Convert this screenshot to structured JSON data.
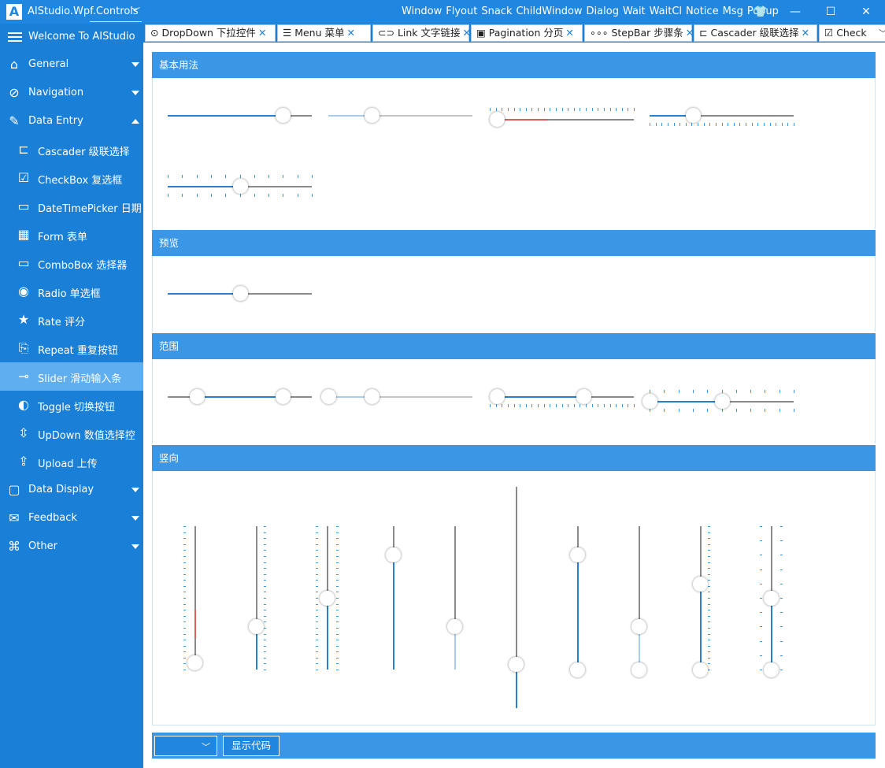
{
  "app": {
    "logo": "A",
    "title": "AIStudio.Wpf.Controls",
    "title_arrow": "﹀",
    "menu": [
      "Window",
      "Flyout",
      "Snack",
      "ChildWindow",
      "Dialog",
      "Wait",
      "WaitCl",
      "Notice",
      "Msg",
      "Popup"
    ],
    "window_buttons": {
      "skin": "👕",
      "minimize": "—",
      "maximize": "☐",
      "close": "✕"
    }
  },
  "sidebar": {
    "header": "Welcome To AIStudio",
    "items": [
      {
        "label": "General",
        "icon": "home-icon",
        "glyph": "⌂",
        "expand": "down"
      },
      {
        "label": "Navigation",
        "icon": "compass-icon",
        "glyph": "⊘",
        "expand": "down"
      },
      {
        "label": "Data Entry",
        "icon": "edit-icon",
        "glyph": "✎",
        "expand": "up"
      },
      {
        "label": "Cascader 级联选择",
        "icon": "cascader-icon",
        "glyph": "⊏",
        "sub": true
      },
      {
        "label": "CheckBox 复选框",
        "icon": "checkbox-icon",
        "glyph": "☑",
        "sub": true
      },
      {
        "label": "DateTimePicker 日期",
        "icon": "datetime-icon",
        "glyph": "▭",
        "sub": true
      },
      {
        "label": "Form 表单",
        "icon": "form-icon",
        "glyph": "▦",
        "sub": true
      },
      {
        "label": "ComboBox 选择器",
        "icon": "combobox-icon",
        "glyph": "▭",
        "sub": true
      },
      {
        "label": "Radio 单选框",
        "icon": "radio-icon",
        "glyph": "◉",
        "sub": true
      },
      {
        "label": "Rate 评分",
        "icon": "star-icon",
        "glyph": "★",
        "sub": true
      },
      {
        "label": "Repeat 重复按钮",
        "icon": "repeat-icon",
        "glyph": "⎘",
        "sub": true
      },
      {
        "label": "Slider 滑动输入条",
        "icon": "slider-icon",
        "glyph": "⊸",
        "sub": true,
        "active": true
      },
      {
        "label": "Toggle 切换按钮",
        "icon": "toggle-icon",
        "glyph": "◐",
        "sub": true
      },
      {
        "label": "UpDown 数值选择控",
        "icon": "updown-icon",
        "glyph": "⇳",
        "sub": true
      },
      {
        "label": "Upload 上传",
        "icon": "upload-icon",
        "glyph": "⇪",
        "sub": true
      },
      {
        "label": "Data Display",
        "icon": "data-display-icon",
        "glyph": "▢",
        "expand": "down"
      },
      {
        "label": "Feedback",
        "icon": "feedback-icon",
        "glyph": "✉",
        "expand": "down"
      },
      {
        "label": "Other",
        "icon": "other-icon",
        "glyph": "⌘",
        "expand": "down"
      }
    ]
  },
  "tabs": [
    {
      "label": "DropDown 下拉控件",
      "icon": "dropdown-icon",
      "glyph": "⊙"
    },
    {
      "label": "Menu 菜单",
      "icon": "menu-icon",
      "glyph": "☰"
    },
    {
      "label": "Link 文字链接",
      "icon": "link-icon",
      "glyph": "⊂⊃"
    },
    {
      "label": "Pagination 分页",
      "icon": "pagination-icon",
      "glyph": "▣"
    },
    {
      "label": "StepBar 步骤条",
      "icon": "stepbar-icon",
      "glyph": "∘∘∘"
    },
    {
      "label": "Cascader 级联选择",
      "icon": "cascader-icon",
      "glyph": "⊏"
    },
    {
      "label": "Check",
      "icon": "checkbox-icon",
      "glyph": "☑"
    }
  ],
  "tab_close": "✕",
  "tab_overflow": "﹀",
  "sections": {
    "basic": "基本用法",
    "preview": "预览",
    "range": "范围",
    "vertical": "竖向"
  },
  "sliders": {
    "basic": [
      {
        "value": 0.8,
        "style": "normal"
      },
      {
        "value": 0.3,
        "style": "disabled"
      },
      {
        "value": 0.05,
        "style": "ticks-top-red"
      },
      {
        "value": 0.3,
        "style": "ticks-bottom"
      },
      {
        "value": 0.5,
        "style": "ticks-both"
      }
    ],
    "preview": [
      {
        "value": 0.5,
        "style": "normal"
      }
    ],
    "range": [
      {
        "low": 0.2,
        "high": 0.8,
        "style": "normal"
      },
      {
        "low": 0.0,
        "high": 0.3,
        "style": "disabled"
      },
      {
        "low": 0.05,
        "high": 0.65,
        "style": "ticks-bottom"
      },
      {
        "low": 0.0,
        "high": 0.5,
        "style": "ticks-both"
      }
    ],
    "vertical": [
      {
        "value": 0.05,
        "style": "ticks-left-red"
      },
      {
        "value": 0.3,
        "style": "ticks-right"
      },
      {
        "value": 0.5,
        "style": "ticks-both"
      },
      {
        "value": 0.8,
        "style": "normal"
      },
      {
        "value": 0.3,
        "style": "disabled"
      },
      {
        "value": 0.2,
        "style": "tall"
      },
      {
        "low": 0.0,
        "high": 0.8,
        "style": "range"
      },
      {
        "low": 0.0,
        "high": 0.3,
        "style": "range-disabled"
      },
      {
        "low": 0.0,
        "high": 0.6,
        "style": "range-ticks-right"
      },
      {
        "low": 0.0,
        "high": 0.5,
        "style": "range-ticks-both"
      }
    ]
  },
  "bottom": {
    "theme_value": "",
    "theme_arrow": "﹀",
    "show_code": "显示代码"
  },
  "colors": {
    "accent": "#1a7fd6",
    "section_header": "#3b97e6",
    "slider_fill": "#2b7fd0",
    "slider_red": "#e25c5c"
  }
}
